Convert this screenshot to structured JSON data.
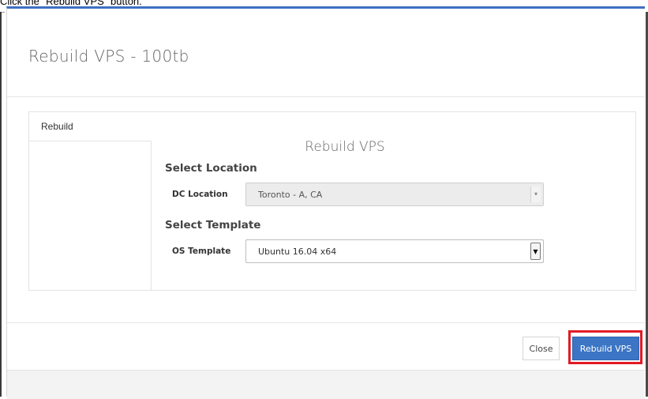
{
  "instruction": "Click the \"Rebuild VPS\" button.",
  "modal": {
    "title": "Rebuild VPS - 100tb",
    "tabs": [
      {
        "label": "Rebuild",
        "active": true
      }
    ],
    "section_title": "Rebuild VPS",
    "location": {
      "heading": "Select Location",
      "field_label": "DC Location",
      "value": "Toronto - A, CA",
      "disabled": true
    },
    "template": {
      "heading": "Select Template",
      "field_label": "OS Template",
      "value": "Ubuntu 16.04 x64",
      "disabled": false
    },
    "footer": {
      "close_label": "Close",
      "rebuild_label": "Rebuild VPS"
    }
  },
  "colors": {
    "primary": "#3b75c4",
    "highlight": "#e01b24",
    "header_accent": "#3f6fc2"
  }
}
